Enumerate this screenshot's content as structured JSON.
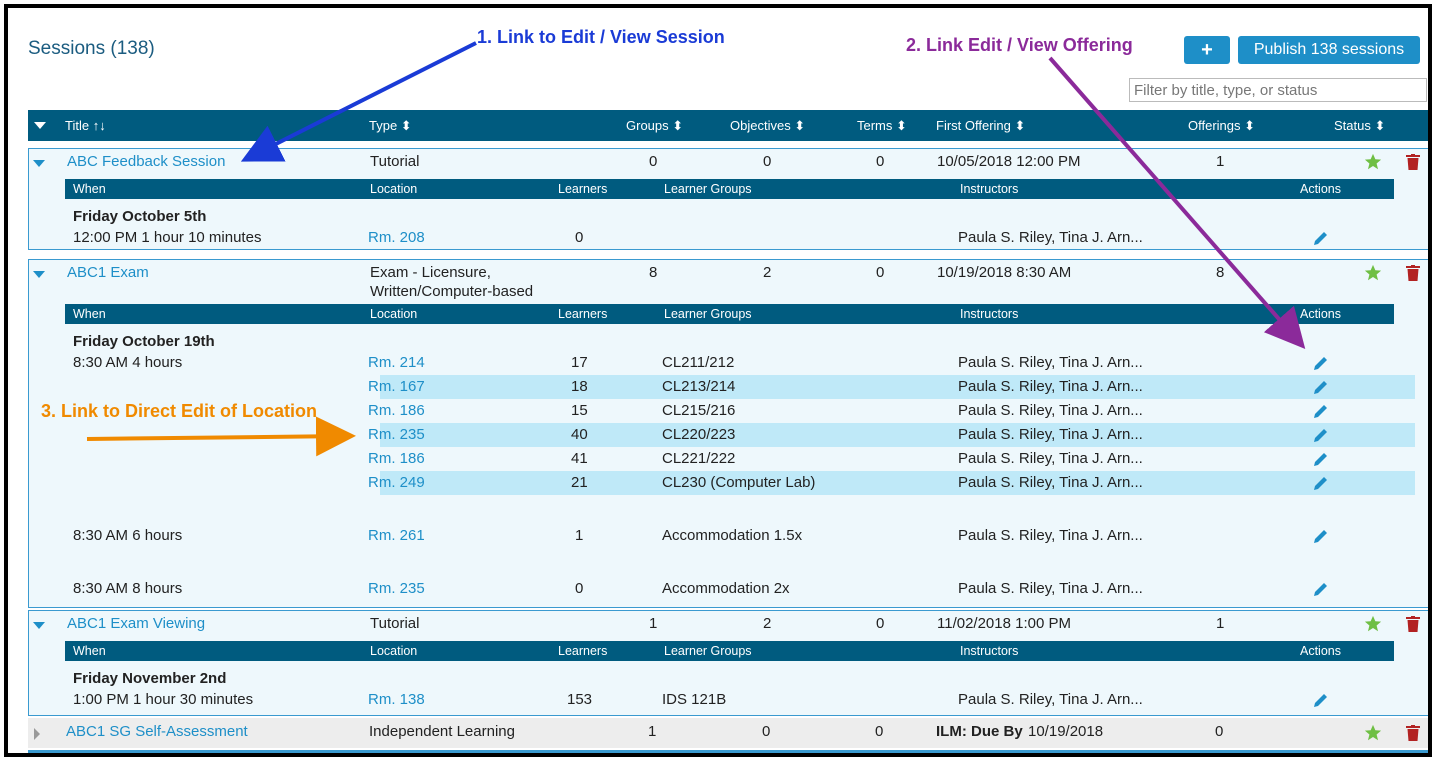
{
  "header": {
    "title": "Sessions (138)",
    "add_label": "+",
    "publish_label": "Publish 138 sessions",
    "filter_placeholder": "Filter by title, type, or status"
  },
  "columns": {
    "title": "Title ↑↓",
    "type": "Type ⬍",
    "groups": "Groups ⬍",
    "objectives": "Objectives ⬍",
    "terms": "Terms ⬍",
    "first_offering": "First Offering ⬍",
    "offerings": "Offerings ⬍",
    "status": "Status ⬍"
  },
  "subcolumns": {
    "when": "When",
    "location": "Location",
    "learners": "Learners",
    "learner_groups": "Learner Groups",
    "instructors": "Instructors",
    "actions": "Actions"
  },
  "sessions": [
    {
      "title": "ABC Feedback Session",
      "type": "Tutorial",
      "groups": "0",
      "objectives": "0",
      "terms": "0",
      "first_offering": "10/05/2018 12:00 PM",
      "offerings": "1",
      "date": "Friday October 5th",
      "offerings_rows": [
        {
          "when": "12:00 PM 1 hour 10 minutes",
          "location": "Rm. 208",
          "learners": "0",
          "group": "",
          "instructors": "Paula S. Riley, Tina J. Arn..."
        }
      ]
    },
    {
      "title": "ABC1 Exam",
      "type": "Exam - Licensure,",
      "type2": "Written/Computer-based",
      "groups": "8",
      "objectives": "2",
      "terms": "0",
      "first_offering": "10/19/2018 8:30 AM",
      "offerings": "8",
      "date": "Friday October 19th",
      "offerings_rows": [
        {
          "when": "8:30 AM 4 hours",
          "location": "Rm. 214",
          "learners": "17",
          "group": "CL211/212",
          "instructors": "Paula S. Riley, Tina J. Arn..."
        },
        {
          "when": "",
          "location": "Rm. 167",
          "learners": "18",
          "group": "CL213/214",
          "instructors": "Paula S. Riley, Tina J. Arn..."
        },
        {
          "when": "",
          "location": "Rm. 186",
          "learners": "15",
          "group": "CL215/216",
          "instructors": "Paula S. Riley, Tina J. Arn..."
        },
        {
          "when": "",
          "location": "Rm. 235",
          "learners": "40",
          "group": "CL220/223",
          "instructors": "Paula S. Riley, Tina J. Arn..."
        },
        {
          "when": "",
          "location": "Rm. 186",
          "learners": "41",
          "group": "CL221/222",
          "instructors": "Paula S. Riley, Tina J. Arn..."
        },
        {
          "when": "",
          "location": "Rm. 249",
          "learners": "21",
          "group": "CL230 (Computer Lab)",
          "instructors": "Paula S. Riley, Tina J. Arn..."
        },
        {
          "when": "8:30 AM 6 hours",
          "location": "Rm. 261",
          "learners": "1",
          "group": "Accommodation 1.5x",
          "instructors": "Paula S. Riley, Tina J. Arn..."
        },
        {
          "when": "8:30 AM 8 hours",
          "location": "Rm. 235",
          "learners": "0",
          "group": "Accommodation 2x",
          "instructors": "Paula S. Riley, Tina J. Arn..."
        }
      ]
    },
    {
      "title": "ABC1 Exam Viewing",
      "type": "Tutorial",
      "groups": "1",
      "objectives": "2",
      "terms": "0",
      "first_offering": "11/02/2018 1:00 PM",
      "offerings": "1",
      "date": "Friday November 2nd",
      "offerings_rows": [
        {
          "when": "1:00 PM 1 hour 30 minutes",
          "location": "Rm. 138",
          "learners": "153",
          "group": "IDS 121B",
          "instructors": "Paula S. Riley, Tina J. Arn..."
        }
      ]
    },
    {
      "title": "ABC1 SG Self-Assessment",
      "type": "Independent Learning",
      "groups": "1",
      "objectives": "0",
      "terms": "0",
      "first_offering_bold": "ILM: Due By",
      "first_offering": "10/19/2018",
      "offerings": "0"
    }
  ],
  "annotations": {
    "a1": "1. Link to Edit / View Session",
    "a2": "2. Link Edit / View Offering",
    "a3": "3. Link to Direct Edit of Location"
  },
  "colors": {
    "accent": "#1e8fc8",
    "header": "#005b7f",
    "row_bg": "#eef8fc",
    "highlight": "#bfe9f8",
    "star": "#6fbf44",
    "trash": "#b22222",
    "annot1": "#1a3bd6",
    "annot2": "#8b2a9a",
    "annot3": "#f08a00"
  }
}
